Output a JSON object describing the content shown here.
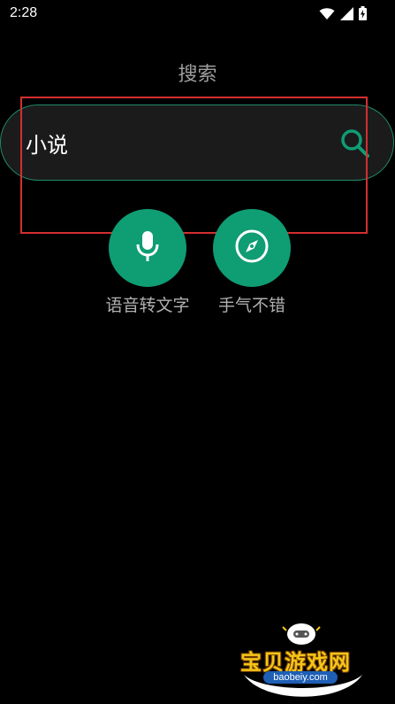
{
  "status_bar": {
    "time": "2:28",
    "icons": [
      "wifi-icon",
      "signal-icon",
      "battery-icon"
    ]
  },
  "page": {
    "title": "搜索"
  },
  "search": {
    "value": "小说",
    "icon": "search-icon"
  },
  "actions": [
    {
      "label": "语音转文字",
      "icon": "microphone-icon"
    },
    {
      "label": "手气不错",
      "icon": "compass-icon"
    }
  ],
  "watermark": {
    "title": "宝贝游戏网",
    "url": "baobeiy.com"
  },
  "colors": {
    "background": "#000000",
    "accent": "#0f9d74",
    "search_border": "#1f8a6a",
    "highlight": "#d32f2f",
    "muted_text": "#9e9e9e"
  }
}
